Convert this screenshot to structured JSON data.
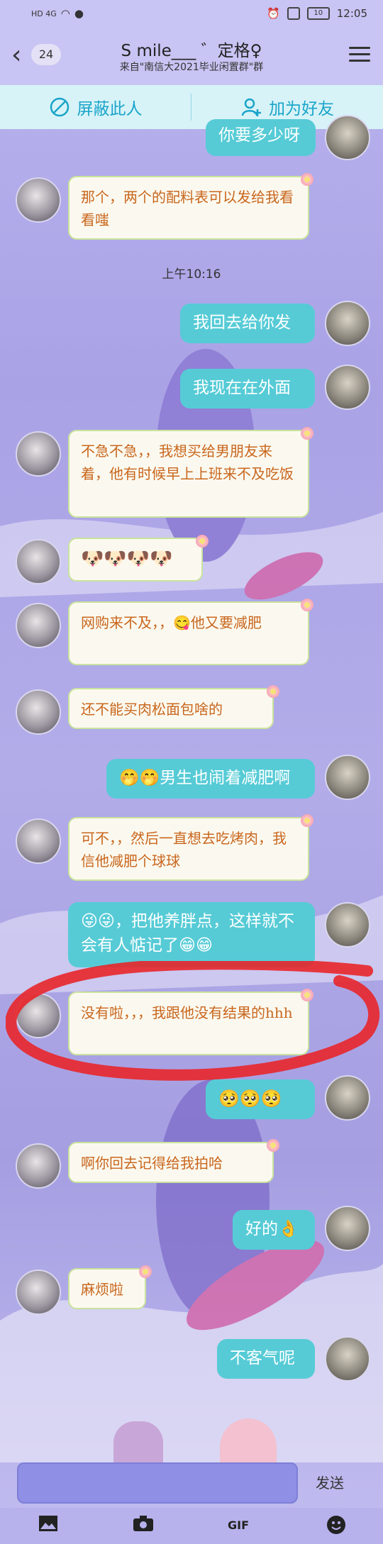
{
  "status": {
    "network": "HD 4G",
    "time": "12:05",
    "battery": "10"
  },
  "header": {
    "back_count": "24",
    "title": "S mile___ ゛定格♀",
    "subtitle": "来自\"南信大2021毕业闲置群\"群"
  },
  "actions": {
    "block_label": "屏蔽此人",
    "add_friend_label": "加为好友"
  },
  "timestamp": "上午10:16",
  "messages": [
    {
      "side": "right",
      "text": "你要多少呀"
    },
    {
      "side": "left",
      "text": "那个，两个的配料表可以发给我看看嗤"
    },
    {
      "side": "right",
      "text": "我回去给你发"
    },
    {
      "side": "right",
      "text": "我现在在外面"
    },
    {
      "side": "left",
      "text": "不急不急，，我想买给男朋友来着，他有时候早上上班来不及吃饭"
    },
    {
      "side": "left",
      "text": "🐶🐶🐶🐶"
    },
    {
      "side": "left",
      "text": "网购来不及，，😋他又要减肥"
    },
    {
      "side": "left",
      "text": "还不能买肉松面包啥的"
    },
    {
      "side": "right",
      "text": "🤭🤭男生也闹着减肥啊"
    },
    {
      "side": "left",
      "text": "可不，，然后一直想去吃烤肉，我信他减肥个球球"
    },
    {
      "side": "right",
      "text": "😜😜，把他养胖点，这样就不会有人惦记了😁😁"
    },
    {
      "side": "left",
      "text": "没有啦，，，我跟他没有结果的hhh"
    },
    {
      "side": "right",
      "text": "🥺🥺🥺"
    },
    {
      "side": "left",
      "text": "啊你回去记得给我拍哈"
    },
    {
      "side": "right",
      "text": "好的👌"
    },
    {
      "side": "left",
      "text": "麻烦啦"
    },
    {
      "side": "right",
      "text": "不客气呢"
    }
  ],
  "input": {
    "placeholder": "",
    "send_label": "发送"
  },
  "toolbar": [
    "image-icon",
    "camera-icon",
    "gif-icon",
    "emoji-icon"
  ],
  "colors": {
    "header_bg": "#c8c4f3",
    "action_text": "#1aa4c9",
    "right_bubble": "#56cbd6",
    "left_bubble_text": "#c9661d",
    "marker": "#e8262a"
  }
}
